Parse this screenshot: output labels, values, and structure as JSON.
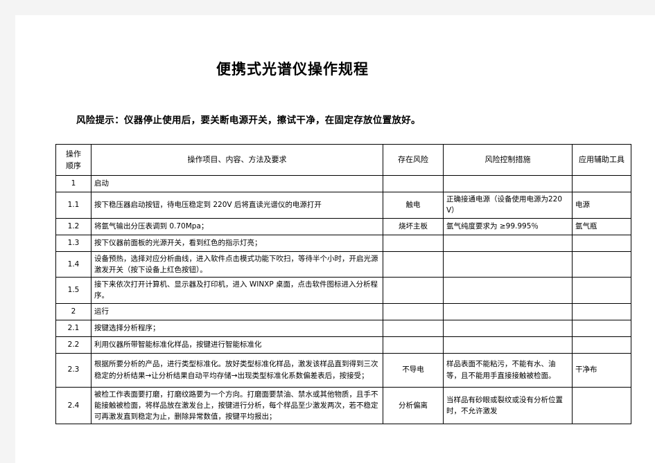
{
  "document": {
    "title": "便携式光谱仪操作规程",
    "risk_note": "风险提示：仪器停止使用后，要关断电源开关，擦试干净，在固定存放位置放好。"
  },
  "table": {
    "headers": {
      "sequence": "操作顺序",
      "item": "操作项目、内容、方法及要求",
      "risk": "存在风险",
      "control": "风险控制措施",
      "tool": "应用辅助工具"
    },
    "header_sequence_line1": "操作",
    "header_sequence_line2": "顺序",
    "rows": [
      {
        "seq": "1",
        "item": "启动",
        "risk": "",
        "control": "",
        "tool": ""
      },
      {
        "seq": "1.1",
        "item": "按下稳压器启动按钮，待电压稳定到 220V 后将直读光谱仪的电源打开",
        "risk": "触电",
        "control": "正确接通电源（设备使用电源为220V）",
        "tool": "电源"
      },
      {
        "seq": "1.2",
        "item": "将氩气输出分压表调到 0.70Mpa；",
        "risk": "烧坏主板",
        "control": "氩气纯度要求为 ≥99.995％",
        "tool": "氩气瓶"
      },
      {
        "seq": "1.3",
        "item": "按下仪器前面板的光源开关，看到红色的指示灯亮；",
        "risk": "",
        "control": "",
        "tool": ""
      },
      {
        "seq": "1.4",
        "item": "设备预热，选择对应分析曲线，进入软件点击模式功能下吹扫，等待半个小时，开启光源激发开关（按下设备上红色按钮）。",
        "risk": "",
        "control": "",
        "tool": ""
      },
      {
        "seq": "1.5",
        "item": "接下来依次打开计算机、显示器及打印机，进入 WINXP 桌面，点击软件图标进入分析程序。",
        "risk": "",
        "control": "",
        "tool": ""
      },
      {
        "seq": "2",
        "item": "运行",
        "risk": "",
        "control": "",
        "tool": ""
      },
      {
        "seq": "2.1",
        "item": "按键选择分析程序；",
        "risk": "",
        "control": "",
        "tool": ""
      },
      {
        "seq": "2.2",
        "item": "利用仪器所带智能标准化样品，按键进行智能标准化",
        "risk": "",
        "control": "",
        "tool": ""
      },
      {
        "seq": "2.3",
        "item": "根据所要分析的产品，进行类型标准化。放好类型标准化样品，激发该样品直到得到三次稳定的分析结果→让分析结果自动平均存储→出现类型标准化系数偏差表后，按接受；",
        "risk": "不导电",
        "control": "样品表面不能粘污，不能有水、油等，且不能用手直接接触被检面。",
        "tool": "干净布"
      },
      {
        "seq": "2.4",
        "item": "被检工作表面要打磨，打磨纹路要为一个方向。打磨面要禁油、禁水或其他物质，且手不能接触被检面，将样品放在激发台上，按键进行分析，每个样品至少激发两次，若不稳定可再激发直到稳定为止，删除异常数值，按键平均报出；",
        "risk": "分析偏离",
        "control": "当样品有砂眼或裂纹或没有分析位置时，不允许激发",
        "tool": ""
      }
    ]
  }
}
